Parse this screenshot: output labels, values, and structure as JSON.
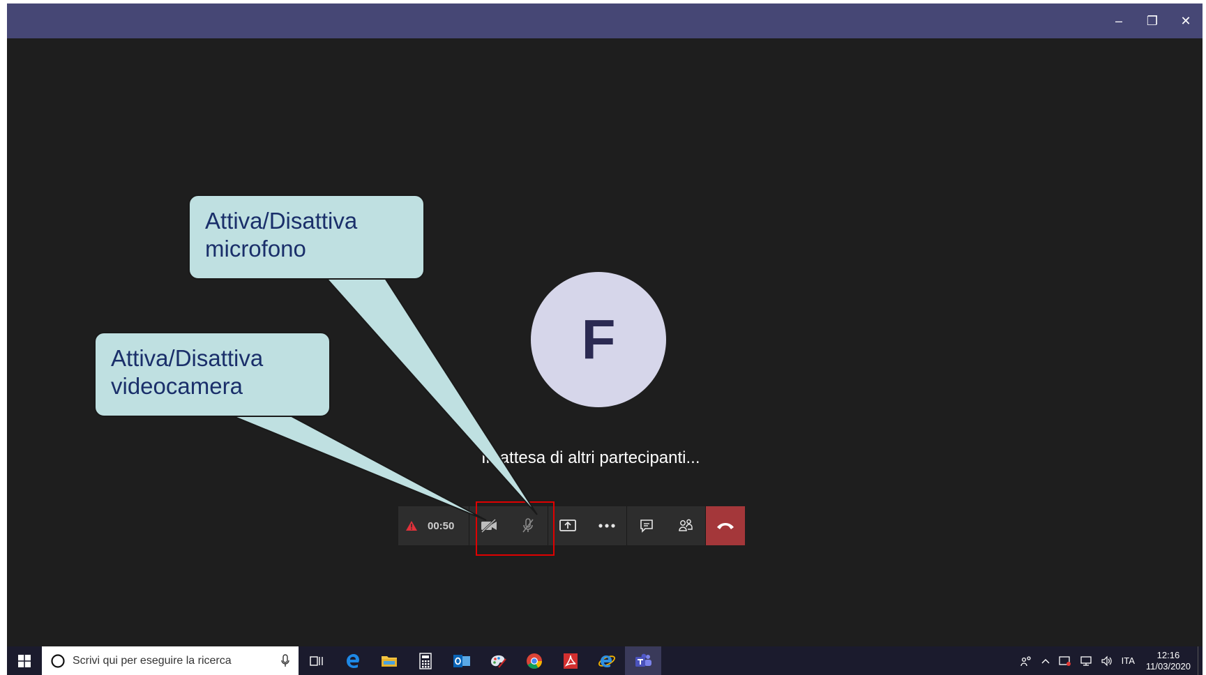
{
  "window": {
    "controls": {
      "minimize": "–",
      "restore": "❐",
      "close": "✕"
    }
  },
  "call": {
    "avatar_initial": "F",
    "waiting_text": "In attesa di altri partecipanti...",
    "timer": "00:50",
    "toolbar_icons": [
      "warning-icon",
      "camera-off-icon",
      "mic-off-icon",
      "share-screen-icon",
      "more-icon",
      "chat-icon",
      "participants-icon",
      "hang-up-icon"
    ]
  },
  "callouts": {
    "microphone": {
      "line1": "Attiva/Disattiva",
      "line2": "microfono"
    },
    "camera": {
      "line1": "Attiva/Disattiva",
      "line2": "videocamera"
    }
  },
  "taskbar": {
    "search_placeholder": "Scrivi qui per eseguire la ricerca",
    "language": "ITA",
    "time": "12:16",
    "date": "11/03/2020"
  },
  "colors": {
    "titlebar": "#464775",
    "stage": "#1e1e1e",
    "hangup": "#a4373a",
    "callout_fill": "#bfe0e1",
    "highlight": "#e00000"
  }
}
